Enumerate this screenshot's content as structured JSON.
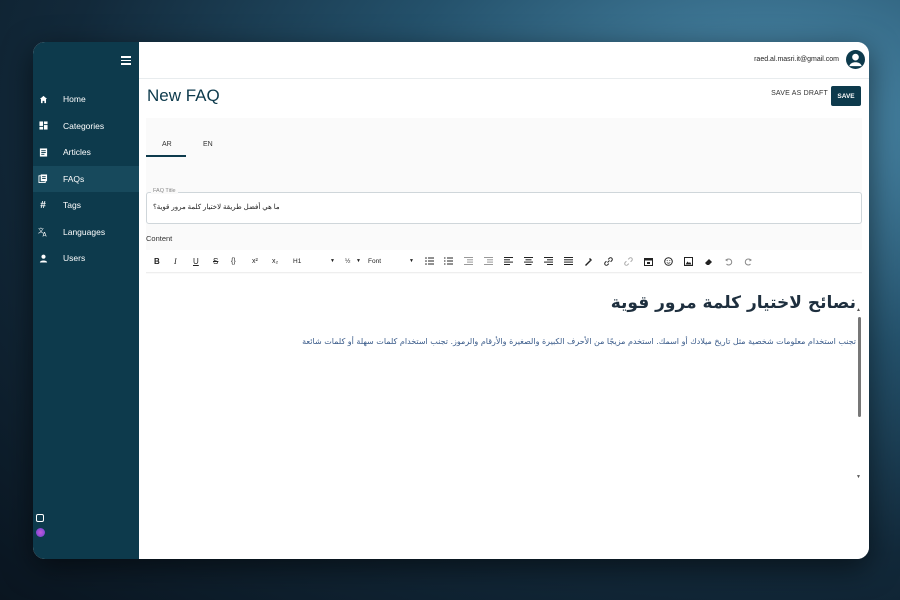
{
  "sidebar": {
    "items": [
      {
        "label": "Home",
        "icon": "home-icon",
        "active": false
      },
      {
        "label": "Categories",
        "icon": "dashboard-icon",
        "active": false
      },
      {
        "label": "Articles",
        "icon": "article-icon",
        "active": false
      },
      {
        "label": "FAQs",
        "icon": "book-icon",
        "active": true
      },
      {
        "label": "Tags",
        "icon": "hashtag-icon",
        "active": false
      },
      {
        "label": "Languages",
        "icon": "translate-icon",
        "active": false
      },
      {
        "label": "Users",
        "icon": "user-icon",
        "active": false
      }
    ]
  },
  "header": {
    "email": "raed.al.masri.it@gmail.com"
  },
  "page": {
    "title": "New FAQ",
    "save_draft_label": "SAVE AS DRAFT",
    "save_label": "SAVE"
  },
  "tabs": [
    {
      "label": "AR",
      "active": true
    },
    {
      "label": "EN",
      "active": false
    }
  ],
  "form": {
    "title_label": "FAQ Title",
    "title_value": "ما هي أفضل طريقة لاختيار كلمة مرور قوية؟",
    "content_label": "Content"
  },
  "toolbar": {
    "heading_select": "H1",
    "size_select": "½",
    "font_select": "Font"
  },
  "editor": {
    "heading": "نصائح لاختيار كلمة مرور قوية",
    "paragraph": "تجنب استخدام معلومات شخصية مثل تاريخ ميلادك أو اسمك. استخدم مزيجًا من الأحرف الكبيرة والصغيرة والأرقام والرموز. تجنب استخدام كلمات سهلة أو كلمات شائعة"
  },
  "colors": {
    "sidebar_bg": "#0d3a4c",
    "accent": "#0d3a4c"
  }
}
